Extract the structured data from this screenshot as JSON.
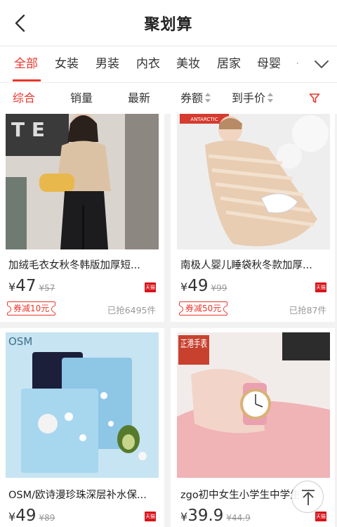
{
  "header": {
    "title": "聚划算"
  },
  "tabs": [
    {
      "label": "全部",
      "active": true
    },
    {
      "label": "女装"
    },
    {
      "label": "男装"
    },
    {
      "label": "内衣"
    },
    {
      "label": "美妆"
    },
    {
      "label": "居家"
    },
    {
      "label": "母婴"
    },
    {
      "label": "·"
    }
  ],
  "sort": [
    {
      "label": "综合",
      "active": true
    },
    {
      "label": "销量"
    },
    {
      "label": "最新"
    },
    {
      "label": "券额"
    },
    {
      "label": "到手价"
    }
  ],
  "products": [
    {
      "name": "加绒毛衣女秋冬韩版加厚短...",
      "currency": "¥",
      "price": "47",
      "orig_price": "¥57",
      "coupon": "券减10元",
      "sold": "已抢6495件",
      "badge": "天猫"
    },
    {
      "name": "南极人婴儿睡袋秋冬款加厚...",
      "currency": "¥",
      "price": "49",
      "orig_price": "¥99",
      "coupon": "券减50元",
      "sold": "已抢87件",
      "badge": "天猫",
      "image_text": "ANTARCTIC"
    },
    {
      "name": "OSM/欧诗漫珍珠深层补水保...",
      "currency": "¥",
      "price": "49",
      "orig_price": "¥89",
      "badge": "天猫",
      "image_text": "OSM"
    },
    {
      "name": "zgo初中女生小学生中学生...",
      "currency": "¥",
      "price": "39.9",
      "orig_price": "¥44.9",
      "badge": "天猫",
      "image_text": "正港手表"
    }
  ],
  "colors": {
    "accent": "#e8362c",
    "tmall": "#d7141a"
  }
}
